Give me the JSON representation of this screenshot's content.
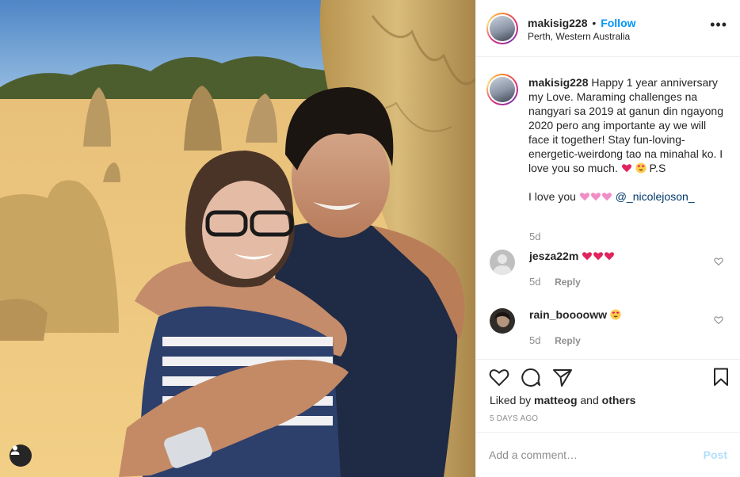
{
  "post": {
    "username": "makisig228",
    "follow_label": "Follow",
    "separator": "•",
    "location": "Perth, Western Australia",
    "more_label": "•••"
  },
  "caption": {
    "username": "makisig228",
    "text_part1": "Happy 1 year anniversary my Love. Maraming challenges na nangyari sa 2019 at ganun din ngayong 2020 pero ang importante ay we will face it together! Stay fun-loving-energetic-weirdong tao na minahal ko. I love you so much.",
    "text_part1_tail": "P.S",
    "text_part2": "I love you",
    "mention": "@_nicolejoson_",
    "age": "5d"
  },
  "comments": [
    {
      "username": "jesza22m",
      "emoji": [
        "red-heart",
        "red-heart",
        "red-heart"
      ],
      "age": "5d",
      "reply_label": "Reply"
    },
    {
      "username": "rain_booooww",
      "emoji": [
        "heart-eyes"
      ],
      "age": "5d",
      "reply_label": "Reply"
    }
  ],
  "likes": {
    "prefix": "Liked by",
    "user": "matteog",
    "joiner": "and",
    "suffix": "others"
  },
  "timestamp": "5 DAYS AGO",
  "add_comment": {
    "placeholder": "Add a comment…",
    "post_label": "Post"
  },
  "colors": {
    "link_blue": "#0095f6",
    "mention_blue": "#00376b",
    "muted": "#8e8e8e",
    "post_disabled": "#b2dffc"
  }
}
